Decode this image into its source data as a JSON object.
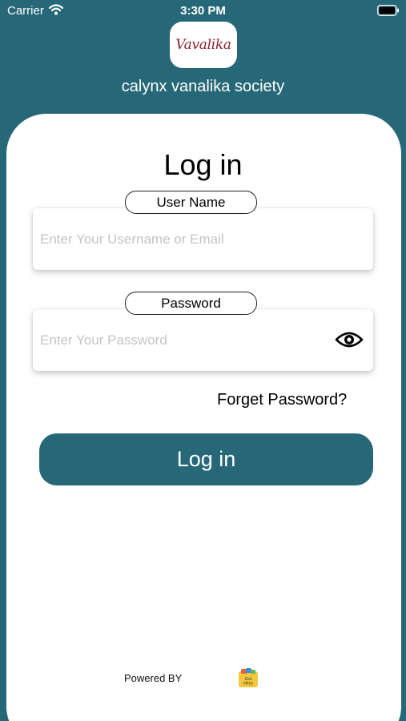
{
  "status_bar": {
    "carrier": "Carrier",
    "time": "3:30 PM"
  },
  "header": {
    "logo_text": "Vavalika",
    "society_name": "calynx vanalika society"
  },
  "login": {
    "title": "Log in",
    "username_label": "User Name",
    "username_placeholder": "Enter Your Username or Email",
    "username_value": "",
    "password_label": "Password",
    "password_placeholder": "Enter Your Password",
    "password_value": "",
    "forgot_label": "Forget Password?",
    "button_label": "Log in"
  },
  "footer": {
    "powered_by": "Powered BY",
    "powered_logo_text": "Got eKey"
  },
  "colors": {
    "brand": "#276878",
    "card": "#ffffff",
    "logo_text": "#8b2230"
  },
  "icons": {
    "wifi": "wifi-icon",
    "battery": "battery-icon",
    "password_toggle": "eye-icon",
    "powered_logo": "ekey-logo-icon"
  }
}
